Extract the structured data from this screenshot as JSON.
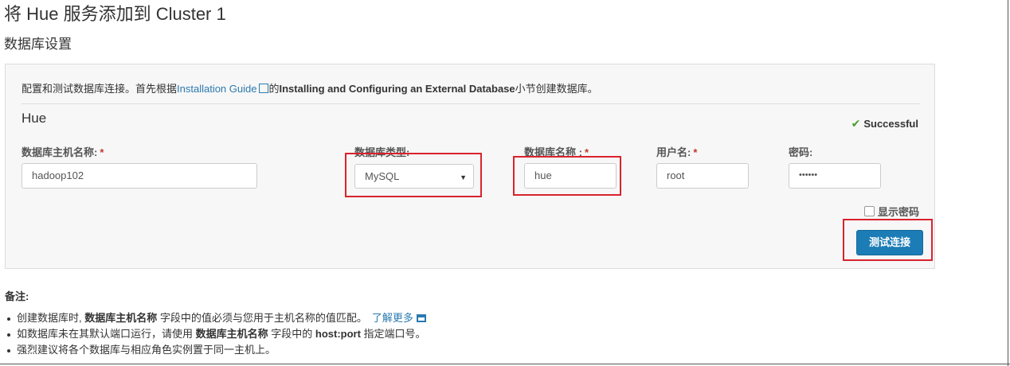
{
  "page": {
    "title": "将 Hue 服务添加到 Cluster 1",
    "section_title": "数据库设置"
  },
  "panel": {
    "intro_prefix": "配置和测试数据库连接。首先根据",
    "intro_link": "Installation Guide",
    "intro_mid": "的",
    "intro_bold": "Installing and Configuring an External Database",
    "intro_suffix": "小节创建数据库。",
    "service_name": "Hue",
    "status_text": "Successful",
    "status_icon": "check-icon",
    "fields": {
      "host_label": "数据库主机名称:",
      "host_value": "hadoop102",
      "type_label": "数据库类型:",
      "type_value": "MySQL",
      "dbname_label": "数据库名称 :",
      "dbname_value": "hue",
      "user_label": "用户名:",
      "user_value": "root",
      "password_label": "密码:",
      "password_value": "••••••",
      "required_mark": "*"
    },
    "show_password_label": "显示密码",
    "test_button_label": "测试连接"
  },
  "notes": {
    "title": "备注:",
    "n1_a": "创建数据库时,",
    "n1_b": "数据库主机名称",
    "n1_c": " 字段中的值必须与您用于主机名称的值匹配。",
    "n1_link": "了解更多",
    "n2_a": "如数据库未在其默认端口运行，请使用 ",
    "n2_b": "数据库主机名称",
    "n2_c": " 字段中的 ",
    "n2_d": "host:port",
    "n2_e": " 指定端口号。",
    "n3": "强烈建议将各个数据库与相应角色实例置于同一主机上。"
  },
  "colors": {
    "accent": "#1c7cb5",
    "link": "#2a7ab0",
    "success": "#4a9c2d",
    "highlight_box": "#d9232d"
  }
}
